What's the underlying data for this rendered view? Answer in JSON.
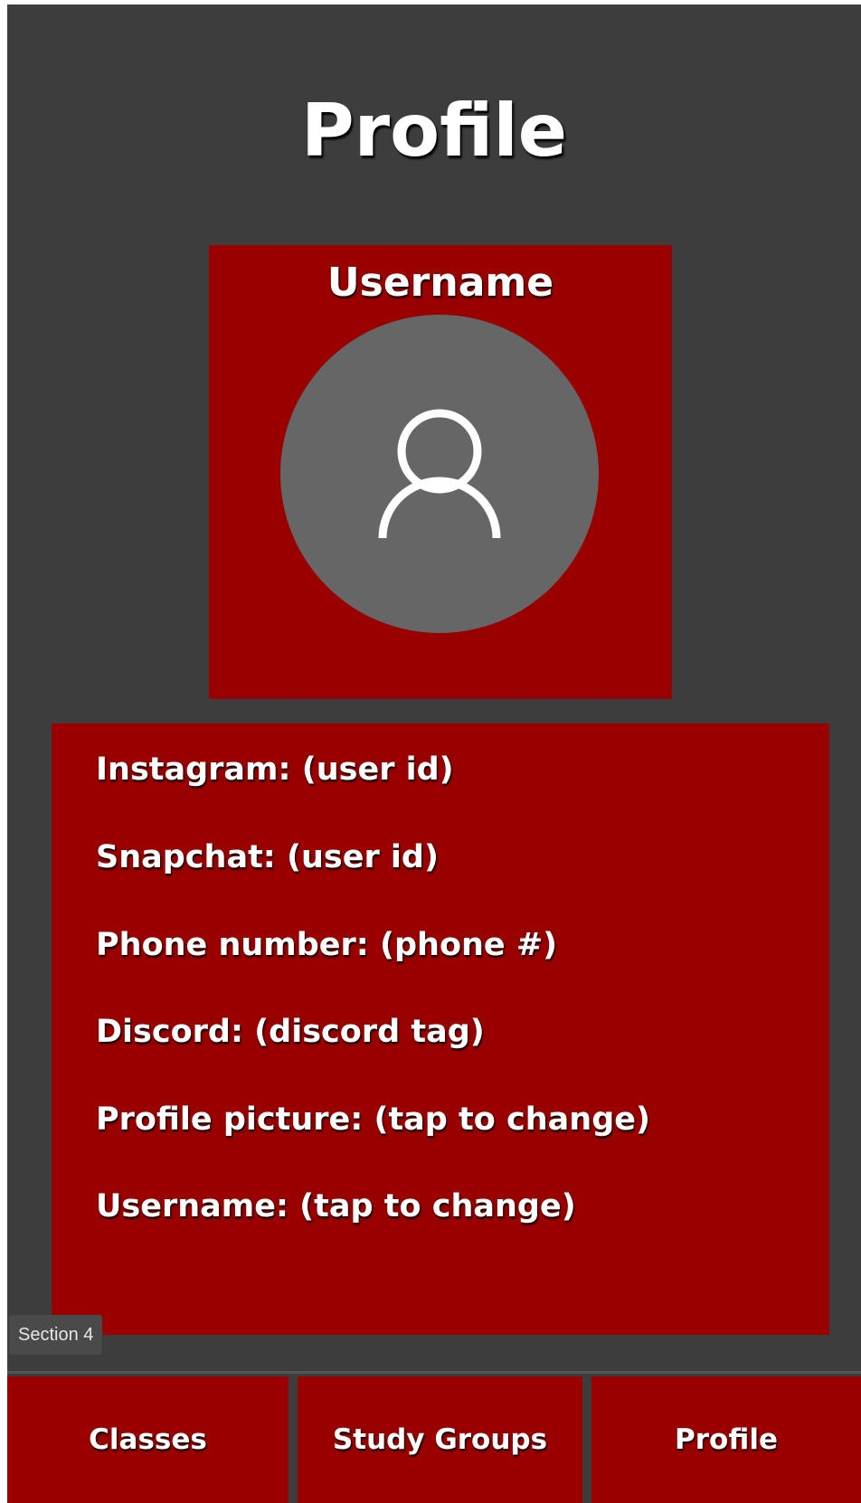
{
  "header": {
    "title": "Profile"
  },
  "profile_card": {
    "username": "Username",
    "avatar_icon": "user-icon"
  },
  "info": {
    "rows": [
      {
        "label": "Instagram: (user id)"
      },
      {
        "label": "Snapchat: (user id)"
      },
      {
        "label": "Phone number: (phone #)"
      },
      {
        "label": "Discord: (discord tag)"
      },
      {
        "label": "Profile picture: (tap to change)"
      },
      {
        "label": "Username: (tap to change)"
      }
    ]
  },
  "section_label": "Section 4",
  "nav": {
    "classes": "Classes",
    "study_groups": "Study Groups",
    "profile": "Profile"
  },
  "colors": {
    "background": "#3d3d3d",
    "accent": "#990000",
    "avatar": "#666666",
    "text": "#ffffff"
  }
}
